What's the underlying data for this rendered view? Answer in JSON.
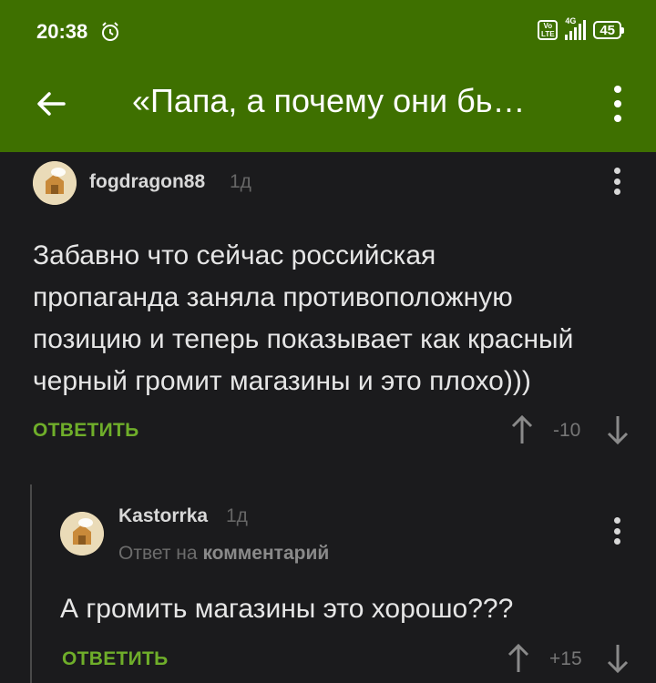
{
  "status": {
    "time": "20:38",
    "network": "4G",
    "battery": "45",
    "volte": "Vo LTE"
  },
  "toolbar": {
    "title": "«Папа, а почему они бь…"
  },
  "comments": [
    {
      "author": "fogdragon88",
      "age": "1д",
      "text_lines": [
        "Забавно что сейчас российская",
        "пропаганда заняла противоположную",
        "позицию и теперь показывает как красный",
        "черный громит магазины и это плохо)))"
      ],
      "reply_label": "ОТВЕТИТЬ",
      "rating": "-10"
    },
    {
      "author": "Kastorrka",
      "age": "1д",
      "reply_to_prefix": "Ответ на",
      "reply_to_link": "комментарий",
      "text_lines": [
        "А громить магазины это хорошо???"
      ],
      "reply_label": "ОТВЕТИТЬ",
      "rating": "+15"
    }
  ],
  "colors": {
    "header": "#3e7000",
    "background": "#1b1b1d",
    "accent": "#6fae2a"
  }
}
